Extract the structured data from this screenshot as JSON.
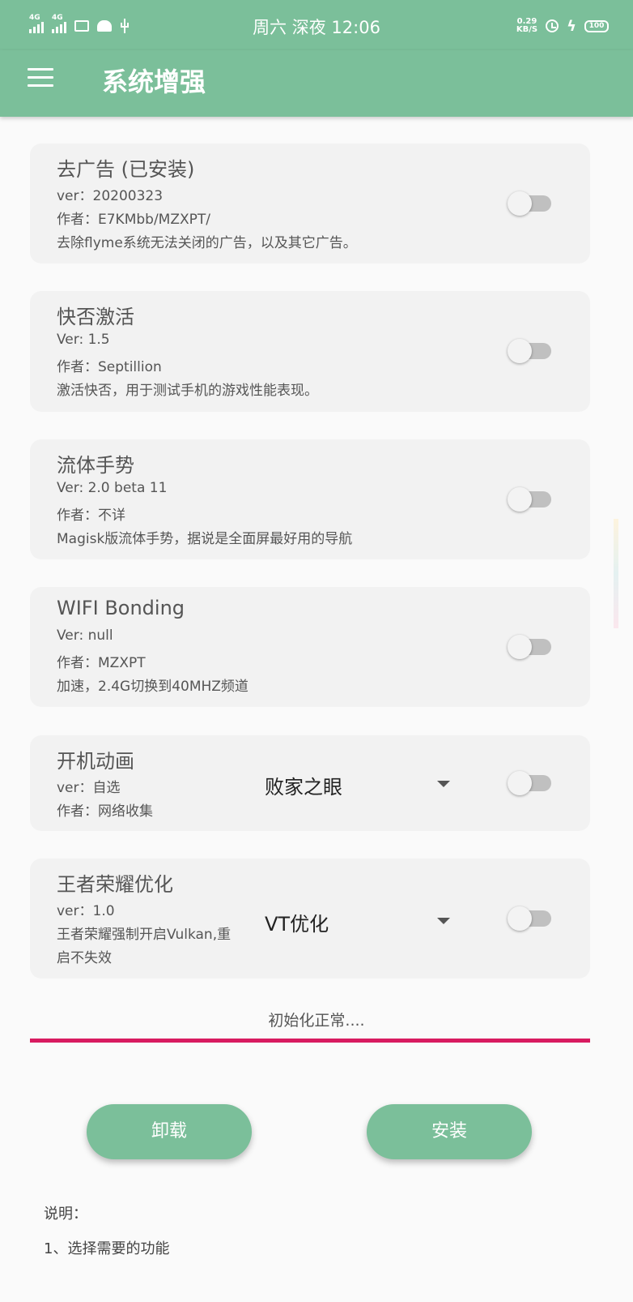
{
  "status_bar": {
    "network_1": "4G",
    "network_2": "4G",
    "time": "周六 深夜 12:06",
    "speed_value": "0.29",
    "speed_unit": "KB/S",
    "battery": "100"
  },
  "app_bar": {
    "title": "系统增强"
  },
  "modules": [
    {
      "title": "去广告 (已安装)",
      "version": "ver：20200323",
      "author": "作者：E7KMbb/MZXPT/",
      "description": "去除flyme系统无法关闭的广告，以及其它广告。",
      "enabled": false
    },
    {
      "title": "快否激活",
      "version": "Ver: 1.5",
      "author": "作者：Septillion",
      "description": "激活快否，用于测试手机的游戏性能表现。",
      "enabled": false
    },
    {
      "title": "流体手势",
      "version": "Ver: 2.0 beta 11",
      "author": "作者：不详",
      "description": "Magisk版流体手势，据说是全面屏最好用的导航",
      "enabled": false
    },
    {
      "title": "WIFI Bonding",
      "version": "Ver: null",
      "author": "作者：MZXPT",
      "description": "加速，2.4G切换到40MHZ频道",
      "enabled": false
    },
    {
      "title": "开机动画",
      "version": "ver：自选",
      "author": "作者：网络收集",
      "selected_option": "败家之眼",
      "enabled": false
    },
    {
      "title": "王者荣耀优化",
      "version": "ver：1.0",
      "description_line1": "王者荣耀强制开启Vulkan,重",
      "description_line2": "启不失效",
      "selected_option": "VT优化",
      "enabled": false
    }
  ],
  "status_text": "初始化正常....",
  "progress": 1.0,
  "colors": {
    "primary": "#7bbf9a",
    "progress": "#d81b60",
    "card": "#f2f2f2"
  },
  "buttons": {
    "uninstall": "卸载",
    "install": "安装"
  },
  "notes": {
    "heading": "说明：",
    "item1": "1、选择需要的功能"
  }
}
